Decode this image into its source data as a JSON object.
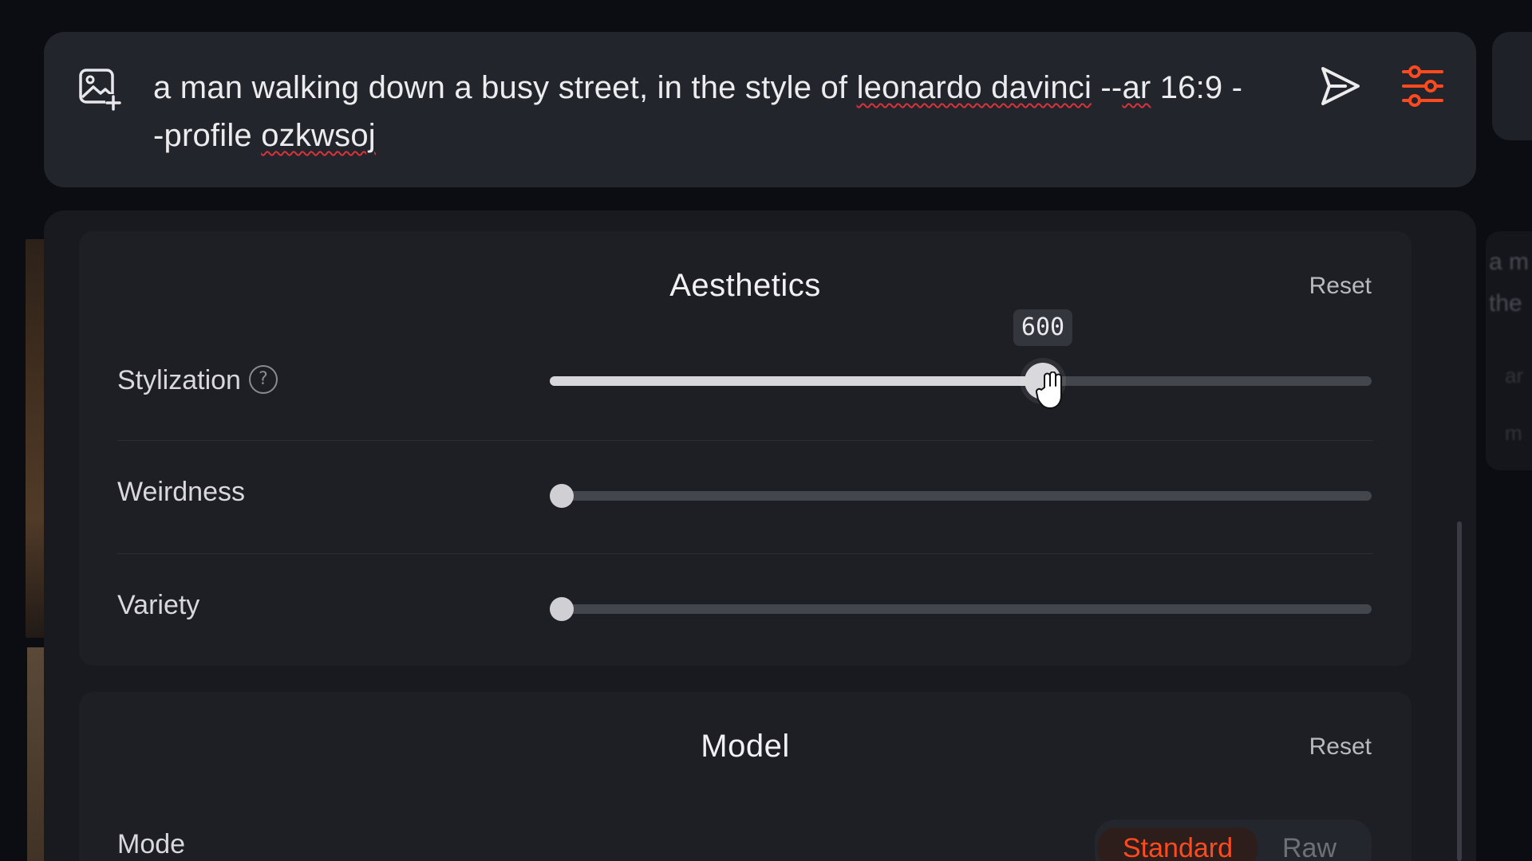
{
  "prompt": {
    "text_part1": "a man walking down a busy street, in the style of ",
    "misspelled1": "leonardo davinci",
    "text_part2": " --",
    "misspelled2": "ar",
    "text_part3": " 16:9 -",
    "text_part4": "-profile ",
    "misspelled3": "ozkwsoj",
    "icons": [
      "image-add-icon",
      "send-icon",
      "sliders-icon"
    ],
    "accent_color": "#ff4a1f"
  },
  "aesthetics": {
    "title": "Aesthetics",
    "reset_label": "Reset",
    "sliders": [
      {
        "label": "Stylization",
        "value": 600,
        "value_label": "600",
        "fraction": 0.6,
        "has_help": true,
        "help_glyph": "?"
      },
      {
        "label": "Weirdness",
        "fraction": 0.0
      },
      {
        "label": "Variety",
        "fraction": 0.0
      }
    ]
  },
  "model": {
    "title": "Model",
    "reset_label": "Reset",
    "mode_label": "Mode",
    "mode_options": [
      "Standard",
      "Raw"
    ],
    "mode_selected": "Standard"
  },
  "background": {
    "ghost_texts": [
      "a m",
      "the",
      "ar",
      "m"
    ]
  }
}
